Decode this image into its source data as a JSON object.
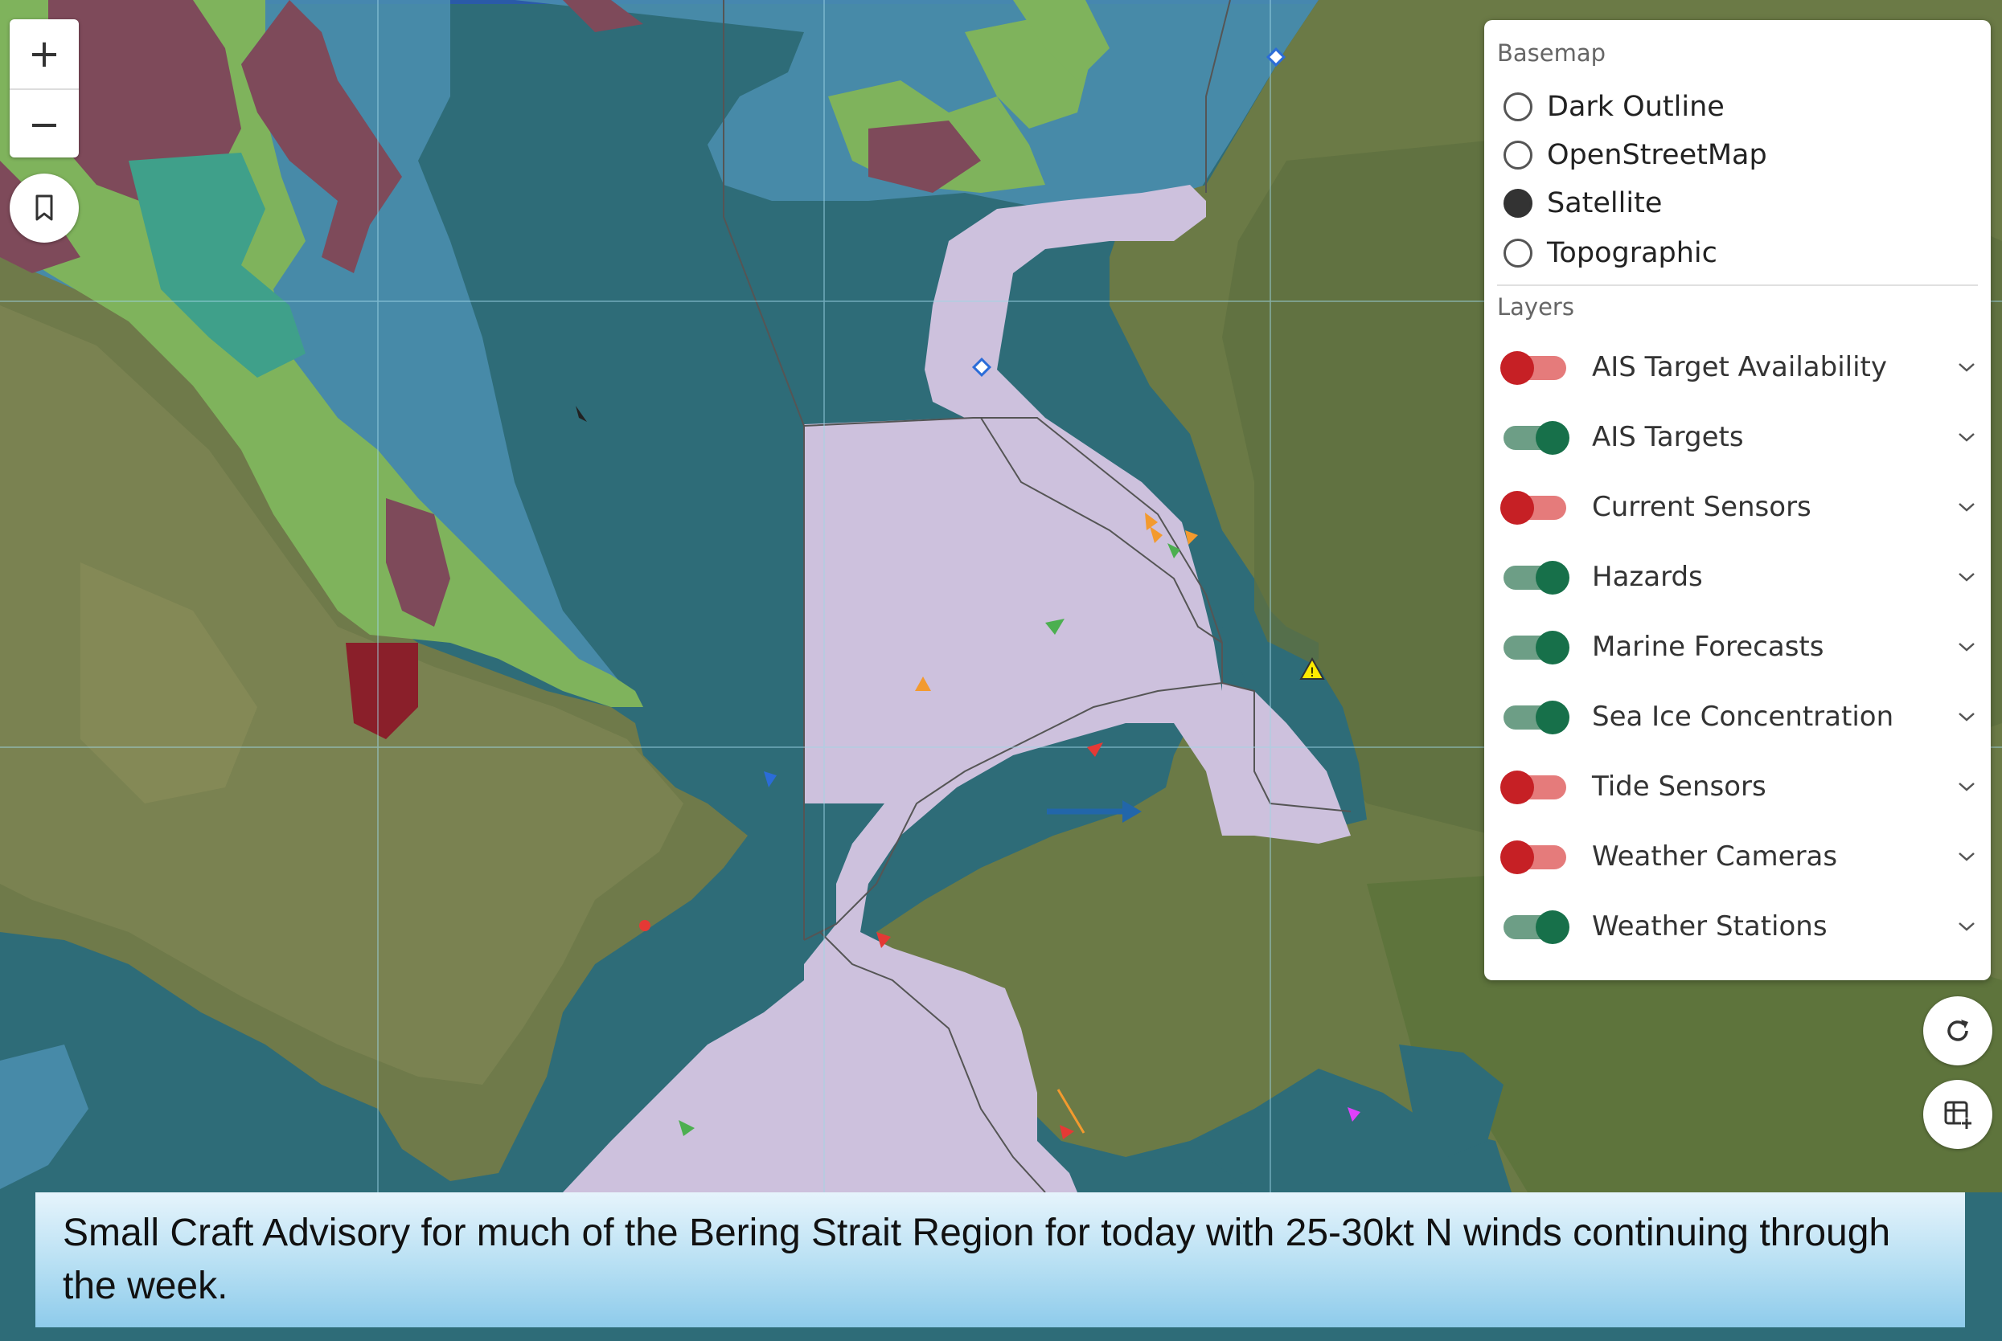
{
  "map": {
    "zoom_in_label": "+",
    "zoom_out_label": "−"
  },
  "basemap": {
    "title": "Basemap",
    "options": [
      {
        "label": "Dark Outline",
        "selected": false
      },
      {
        "label": "OpenStreetMap",
        "selected": false
      },
      {
        "label": "Satellite",
        "selected": true
      },
      {
        "label": "Topographic",
        "selected": false
      }
    ]
  },
  "layers": {
    "title": "Layers",
    "items": [
      {
        "label": "AIS Target Availability",
        "enabled": false
      },
      {
        "label": "AIS Targets",
        "enabled": true
      },
      {
        "label": "Current Sensors",
        "enabled": false
      },
      {
        "label": "Hazards",
        "enabled": true
      },
      {
        "label": "Marine Forecasts",
        "enabled": true
      },
      {
        "label": "Sea Ice Concentration",
        "enabled": true
      },
      {
        "label": "Tide Sensors",
        "enabled": false
      },
      {
        "label": "Weather Cameras",
        "enabled": false
      },
      {
        "label": "Weather Stations",
        "enabled": true
      }
    ]
  },
  "colors": {
    "toggle_on": "#17704a",
    "toggle_off": "#c62025",
    "water": "#2f6f7a",
    "marine_zone": "#cdc1dd"
  },
  "advisory": {
    "text": "Small Craft Advisory for much of the Bering Strait Region for today with 25-30kt N winds continuing through the week."
  }
}
